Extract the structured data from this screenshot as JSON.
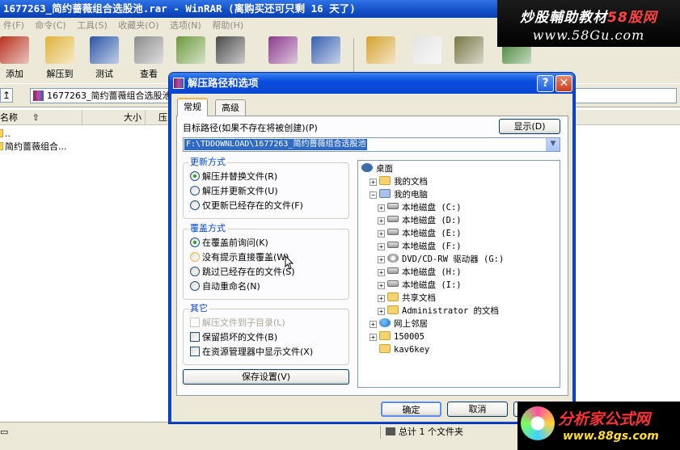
{
  "window": {
    "title": "1677263_简约蔷薇组合选股池.rar - WinRAR (离购买还可只剩 16 天了)"
  },
  "watermarks": {
    "top_line1_a": "炒股輔助教材",
    "top_line1_b": "58股网",
    "top_line2": "www.58Gu.com",
    "bottom_line1": "分析家公式网",
    "bottom_line2": "www.88gs.com"
  },
  "menubar": {
    "items": [
      "件(F)",
      "命令(C)",
      "工具(S)",
      "收藏夹(O)",
      "选项(N)",
      "帮助(H)"
    ]
  },
  "toolbar": {
    "buttons": [
      {
        "label": "添加",
        "icon": "add-archive-icon",
        "color": "#b7311f"
      },
      {
        "label": "解压到",
        "icon": "extract-to-icon",
        "color": "#e0b23a"
      },
      {
        "label": "测试",
        "icon": "test-icon",
        "color": "#2a54a8"
      },
      {
        "label": "查看",
        "icon": "view-icon",
        "color": "#8c8c8c"
      },
      {
        "label": "",
        "icon": "delete-icon",
        "color": "#6b9a3c"
      },
      {
        "label": "",
        "icon": "find-icon",
        "color": "#4a4a4a"
      },
      {
        "label": "",
        "icon": "wizard-icon",
        "color": "#8a3a8c"
      },
      {
        "label": "",
        "icon": "info-icon",
        "color": "#3560b0"
      },
      {
        "label": "",
        "icon": "repair-icon",
        "color": "#d6a22d"
      },
      {
        "label": "",
        "icon": "comment-icon",
        "color": "#e4e4e4"
      },
      {
        "label": "",
        "icon": "protect-icon",
        "color": "#777744"
      },
      {
        "label": "",
        "icon": "sfx-icon",
        "color": "#3a7d2a"
      }
    ]
  },
  "pathbar": {
    "path": "1677263_简约蔷薇组合选股池"
  },
  "list": {
    "columns": [
      "名称",
      "大小",
      "压"
    ],
    "rows": [
      "..",
      "简约蔷薇组合..."
    ]
  },
  "statusbar": {
    "left": "",
    "right": "总计 1 个文件夹"
  },
  "dialog": {
    "title": "解压路径和选项",
    "tabs": [
      "常规",
      "高级"
    ],
    "dest_label": "目标路径(如果不存在将被创建)(P)",
    "show_button": "显示(D)",
    "dest_path": "F:\\TDDOWNLOAD\\1677263_简约蔷薇组合选股池",
    "update_group": {
      "title": "更新方式",
      "options": [
        "解压并替换文件(R)",
        "解压并更新文件(U)",
        "仅更新已经存在的文件(F)"
      ],
      "selected": 0
    },
    "overwrite_group": {
      "title": "覆盖方式",
      "options": [
        "在覆盖前询问(K)",
        "没有提示直接覆盖(W)",
        "跳过已经存在的文件(S)",
        "自动重命名(N)"
      ],
      "selected": 0
    },
    "misc_group": {
      "title": "其它",
      "options": [
        "解压文件到子目录(L)",
        "保留损坏的文件(B)",
        "在资源管理器中显示文件(X)"
      ]
    },
    "save_button": "保存设置(V)",
    "tree": [
      {
        "label": "桌面",
        "icon": "desktop-icon",
        "level": 0,
        "expander": ""
      },
      {
        "label": "我的文档",
        "icon": "my-documents-icon",
        "level": 1,
        "expander": "+"
      },
      {
        "label": "我的电脑",
        "icon": "my-computer-icon",
        "level": 1,
        "expander": "-"
      },
      {
        "label": "本地磁盘 (C:)",
        "icon": "hard-drive-icon",
        "level": 2,
        "expander": "+"
      },
      {
        "label": "本地磁盘 (D:)",
        "icon": "hard-drive-icon",
        "level": 2,
        "expander": "+"
      },
      {
        "label": "本地磁盘 (E:)",
        "icon": "hard-drive-icon",
        "level": 2,
        "expander": "+"
      },
      {
        "label": "本地磁盘 (F:)",
        "icon": "hard-drive-icon",
        "level": 2,
        "expander": "+"
      },
      {
        "label": "DVD/CD-RW 驱动器 (G:)",
        "icon": "cd-drive-icon",
        "level": 2,
        "expander": "+"
      },
      {
        "label": "本地磁盘 (H:)",
        "icon": "hard-drive-icon",
        "level": 2,
        "expander": "+"
      },
      {
        "label": "本地磁盘 (I:)",
        "icon": "hard-drive-icon",
        "level": 2,
        "expander": "+"
      },
      {
        "label": "共享文档",
        "icon": "shared-folder-icon",
        "level": 2,
        "expander": "+"
      },
      {
        "label": "Administrator 的文档",
        "icon": "folder-icon",
        "level": 2,
        "expander": "+"
      },
      {
        "label": "网上邻居",
        "icon": "network-icon",
        "level": 1,
        "expander": "+"
      },
      {
        "label": "150005",
        "icon": "folder-icon",
        "level": 1,
        "expander": "+"
      },
      {
        "label": "kav6key",
        "icon": "folder-icon",
        "level": 1,
        "expander": ""
      }
    ],
    "ok_button": "确定",
    "cancel_button": "取消",
    "help_button": "帮助"
  }
}
